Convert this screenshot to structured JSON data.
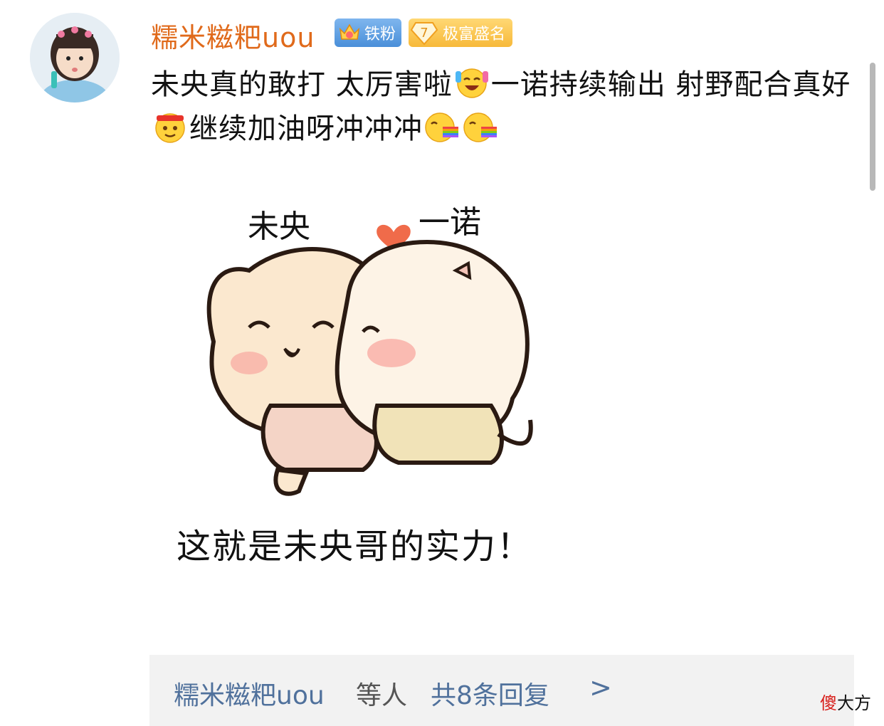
{
  "user": {
    "name": "糯米糍粑uou",
    "badge_fan": "铁粉",
    "badge_rank_level": "7",
    "badge_rank_label": "极富盛名"
  },
  "comment": {
    "part1": "未央真的敢打 太厉害啦",
    "part2": "一诺持续输出 射野配合真好",
    "part3": "继续加油呀冲冲冲"
  },
  "sticker": {
    "name_left": "未央",
    "name_right": "一诺",
    "caption": "这就是未央哥的实力！"
  },
  "replies": {
    "users": "糯米糍粑uou",
    "suffix": "等人",
    "count": "共8条回复",
    "arrow": ">"
  },
  "watermark": {
    "char_red": "傻",
    "rest": "大方"
  },
  "colors": {
    "username": "#e06a1b",
    "link_blue": "#50719c",
    "reply_bg": "#f2f2f2",
    "fan_badge": "#4a8fd9",
    "rank_badge": "#f7b93a"
  },
  "icons": [
    "avatar-photo",
    "crown-icon",
    "diamond-icon",
    "laughing-emoji-icon",
    "headband-emoji-icon",
    "rainbow-emoji-icon",
    "heart-icon"
  ]
}
